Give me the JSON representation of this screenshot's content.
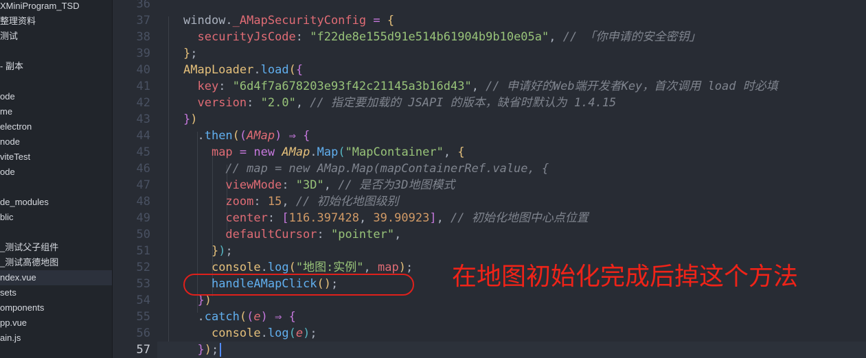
{
  "explorer": {
    "items": [
      {
        "label": "XMiniProgram_TSD",
        "active": false
      },
      {
        "label": "整理资料",
        "active": false
      },
      {
        "label": "测试",
        "active": false
      },
      {
        "label": "",
        "active": false
      },
      {
        "label": "- 副本",
        "active": false
      },
      {
        "label": "",
        "active": false
      },
      {
        "label": "ode",
        "active": false
      },
      {
        "label": "me",
        "active": false
      },
      {
        "label": "electron",
        "active": false
      },
      {
        "label": "node",
        "active": false
      },
      {
        "label": "viteTest",
        "active": false
      },
      {
        "label": "ode",
        "active": false
      },
      {
        "label": "",
        "active": false
      },
      {
        "label": "de_modules",
        "active": false
      },
      {
        "label": "blic",
        "active": false
      },
      {
        "label": "",
        "active": false
      },
      {
        "label": "_测试父子组件",
        "active": false
      },
      {
        "label": "_测试高德地图",
        "active": false
      },
      {
        "label": "ndex.vue",
        "active": true
      },
      {
        "label": "sets",
        "active": false
      },
      {
        "label": "omponents",
        "active": false
      },
      {
        "label": "pp.vue",
        "active": false
      },
      {
        "label": "ain.js",
        "active": false
      }
    ]
  },
  "editor": {
    "current_line": "57",
    "lines": [
      {
        "num": "36",
        "tokens": []
      },
      {
        "num": "37",
        "tokens": [
          [
            "tk-p",
            "window."
          ],
          [
            "tk-prop",
            "_AMapSecurityConfig"
          ],
          [
            "tk-p",
            " "
          ],
          [
            "tk-op",
            "="
          ],
          [
            "tk-p",
            " "
          ],
          [
            "tk-b1",
            "{"
          ]
        ]
      },
      {
        "num": "38",
        "tokens": [
          [
            "tk-p",
            "  "
          ],
          [
            "tk-prop",
            "securityJsCode"
          ],
          [
            "tk-p",
            ": "
          ],
          [
            "tk-str",
            "\"f22de8e155d91e514b61904b9b10e05a\""
          ],
          [
            "tk-p",
            ", "
          ],
          [
            "tk-cm",
            "// 「你申请的安全密钥」"
          ]
        ]
      },
      {
        "num": "39",
        "tokens": [
          [
            "tk-b1",
            "}"
          ],
          [
            "tk-p",
            ";"
          ]
        ]
      },
      {
        "num": "40",
        "tokens": [
          [
            "tk-var",
            "AMapLoader"
          ],
          [
            "tk-p",
            "."
          ],
          [
            "tk-fn",
            "load"
          ],
          [
            "tk-b1",
            "("
          ],
          [
            "tk-b2",
            "{"
          ]
        ]
      },
      {
        "num": "41",
        "tokens": [
          [
            "tk-p",
            "  "
          ],
          [
            "tk-prop",
            "key"
          ],
          [
            "tk-p",
            ": "
          ],
          [
            "tk-str",
            "\"6d4f7a678203e93f42c21145a3b16d43\""
          ],
          [
            "tk-p",
            ", "
          ],
          [
            "tk-cm",
            "// 申请好的Web端开发者Key，首次调用 load 时必填"
          ]
        ]
      },
      {
        "num": "42",
        "tokens": [
          [
            "tk-p",
            "  "
          ],
          [
            "tk-prop",
            "version"
          ],
          [
            "tk-p",
            ": "
          ],
          [
            "tk-str",
            "\"2.0\""
          ],
          [
            "tk-p",
            ", "
          ],
          [
            "tk-cm",
            "// 指定要加载的 JSAPI 的版本，缺省时默认为 1.4.15"
          ]
        ]
      },
      {
        "num": "43",
        "tokens": [
          [
            "tk-b2",
            "}"
          ],
          [
            "tk-b1",
            ")"
          ]
        ]
      },
      {
        "num": "44",
        "tokens": [
          [
            "tk-p",
            "  ."
          ],
          [
            "tk-fn",
            "then"
          ],
          [
            "tk-b1",
            "("
          ],
          [
            "tk-b2",
            "("
          ],
          [
            "tk-param",
            "AMap"
          ],
          [
            "tk-b2",
            ")"
          ],
          [
            "tk-p",
            " "
          ],
          [
            "tk-op",
            "⇒"
          ],
          [
            "tk-p",
            " "
          ],
          [
            "tk-b2",
            "{"
          ]
        ]
      },
      {
        "num": "45",
        "tokens": [
          [
            "tk-p",
            "    "
          ],
          [
            "tk-prop",
            "map"
          ],
          [
            "tk-p",
            " "
          ],
          [
            "tk-op",
            "="
          ],
          [
            "tk-p",
            " "
          ],
          [
            "tk-kw",
            "new"
          ],
          [
            "tk-p",
            " "
          ],
          [
            "tk-cls",
            "AMap"
          ],
          [
            "tk-p",
            "."
          ],
          [
            "tk-fn",
            "Map"
          ],
          [
            "tk-b3",
            "("
          ],
          [
            "tk-str",
            "\"MapContainer\""
          ],
          [
            "tk-p",
            ", "
          ],
          [
            "tk-b1",
            "{"
          ]
        ]
      },
      {
        "num": "46",
        "tokens": [
          [
            "tk-p",
            "      "
          ],
          [
            "tk-cm",
            "// map = new AMap.Map(mapContainerRef.value, {"
          ]
        ]
      },
      {
        "num": "47",
        "tokens": [
          [
            "tk-p",
            "      "
          ],
          [
            "tk-prop",
            "viewMode"
          ],
          [
            "tk-p",
            ": "
          ],
          [
            "tk-str",
            "\"3D\""
          ],
          [
            "tk-p",
            ", "
          ],
          [
            "tk-cm",
            "// 是否为3D地图模式"
          ]
        ]
      },
      {
        "num": "48",
        "tokens": [
          [
            "tk-p",
            "      "
          ],
          [
            "tk-prop",
            "zoom"
          ],
          [
            "tk-p",
            ": "
          ],
          [
            "tk-num",
            "15"
          ],
          [
            "tk-p",
            ", "
          ],
          [
            "tk-cm",
            "// 初始化地图级别"
          ]
        ]
      },
      {
        "num": "49",
        "tokens": [
          [
            "tk-p",
            "      "
          ],
          [
            "tk-prop",
            "center"
          ],
          [
            "tk-p",
            ": "
          ],
          [
            "tk-b2",
            "["
          ],
          [
            "tk-num",
            "116.397428"
          ],
          [
            "tk-p",
            ", "
          ],
          [
            "tk-num",
            "39.90923"
          ],
          [
            "tk-b2",
            "]"
          ],
          [
            "tk-p",
            ", "
          ],
          [
            "tk-cm",
            "// 初始化地图中心点位置"
          ]
        ]
      },
      {
        "num": "50",
        "tokens": [
          [
            "tk-p",
            "      "
          ],
          [
            "tk-prop",
            "defaultCursor"
          ],
          [
            "tk-p",
            ": "
          ],
          [
            "tk-str",
            "\"pointer\""
          ],
          [
            "tk-p",
            ","
          ]
        ]
      },
      {
        "num": "51",
        "tokens": [
          [
            "tk-p",
            "    "
          ],
          [
            "tk-b1",
            "}"
          ],
          [
            "tk-b3",
            ")"
          ],
          [
            "tk-p",
            ";"
          ]
        ]
      },
      {
        "num": "52",
        "tokens": [
          [
            "tk-p",
            "    "
          ],
          [
            "tk-var",
            "console"
          ],
          [
            "tk-p",
            "."
          ],
          [
            "tk-fn",
            "log"
          ],
          [
            "tk-b1",
            "("
          ],
          [
            "tk-str",
            "\"地图:实例\""
          ],
          [
            "tk-p",
            ", "
          ],
          [
            "tk-prop",
            "map"
          ],
          [
            "tk-b1",
            ")"
          ],
          [
            "tk-p",
            ";"
          ]
        ]
      },
      {
        "num": "53",
        "tokens": [
          [
            "tk-p",
            "    "
          ],
          [
            "tk-fn",
            "handleAMapClick"
          ],
          [
            "tk-b1",
            "()"
          ],
          [
            "tk-p",
            ";"
          ]
        ]
      },
      {
        "num": "54",
        "tokens": [
          [
            "tk-p",
            "  "
          ],
          [
            "tk-b2",
            "}"
          ],
          [
            "tk-b1",
            ")"
          ]
        ]
      },
      {
        "num": "55",
        "tokens": [
          [
            "tk-p",
            "  ."
          ],
          [
            "tk-fn",
            "catch"
          ],
          [
            "tk-b1",
            "("
          ],
          [
            "tk-b2",
            "("
          ],
          [
            "tk-param",
            "e"
          ],
          [
            "tk-b2",
            ")"
          ],
          [
            "tk-p",
            " "
          ],
          [
            "tk-op",
            "⇒"
          ],
          [
            "tk-p",
            " "
          ],
          [
            "tk-b2",
            "{"
          ]
        ]
      },
      {
        "num": "56",
        "tokens": [
          [
            "tk-p",
            "    "
          ],
          [
            "tk-var",
            "console"
          ],
          [
            "tk-p",
            "."
          ],
          [
            "tk-fn",
            "log"
          ],
          [
            "tk-b3",
            "("
          ],
          [
            "tk-param",
            "e"
          ],
          [
            "tk-b3",
            ")"
          ],
          [
            "tk-p",
            ";"
          ]
        ]
      },
      {
        "num": "57",
        "tokens": [
          [
            "tk-p",
            "  "
          ],
          [
            "tk-b2",
            "}"
          ],
          [
            "tk-b1",
            ")"
          ],
          [
            "tk-p",
            ";"
          ]
        ]
      }
    ]
  },
  "annotation": {
    "text": "在地图初始化完成后掉这个方法",
    "color": "#f02318"
  },
  "colors": {
    "editor_bg": "#282c34",
    "sidebar_bg": "#21252b",
    "highlight": "#e0201b"
  }
}
